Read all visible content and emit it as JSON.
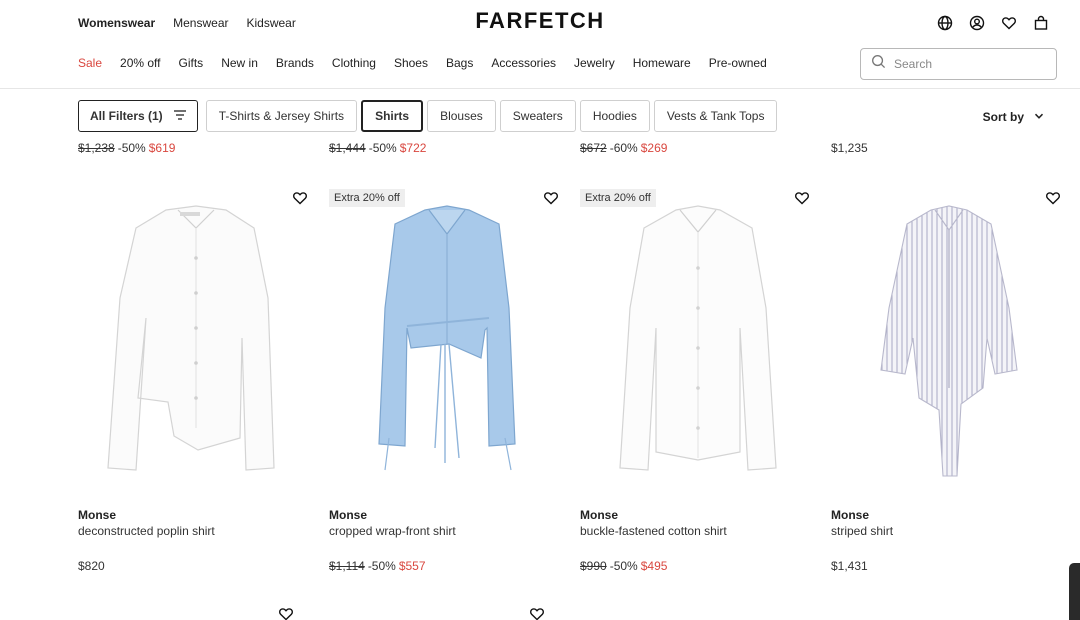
{
  "header": {
    "logo": "FARFETCH",
    "gender_tabs": [
      {
        "label": "Womenswear",
        "active": true
      },
      {
        "label": "Menswear",
        "active": false
      },
      {
        "label": "Kidswear",
        "active": false
      }
    ],
    "icons": [
      "globe-icon",
      "account-icon",
      "wishlist-icon",
      "bag-icon"
    ],
    "categories": [
      "Sale",
      "20% off",
      "Gifts",
      "New in",
      "Brands",
      "Clothing",
      "Shoes",
      "Bags",
      "Accessories",
      "Jewelry",
      "Homeware",
      "Pre-owned"
    ],
    "search_placeholder": "Search"
  },
  "filters": {
    "all_filters_label": "All Filters (1)",
    "chips": [
      {
        "label": "T-Shirts & Jersey Shirts",
        "selected": false
      },
      {
        "label": "Shirts",
        "selected": true
      },
      {
        "label": "Blouses",
        "selected": false
      },
      {
        "label": "Sweaters",
        "selected": false
      },
      {
        "label": "Hoodies",
        "selected": false
      },
      {
        "label": "Vests & Tank Tops",
        "selected": false
      }
    ],
    "sort_label": "Sort by"
  },
  "previous_row_prices": [
    {
      "old": "$1,238",
      "discount": "-50%",
      "sale": "$619"
    },
    {
      "old": "$1,444",
      "discount": "-50%",
      "sale": "$722"
    },
    {
      "old": "$672",
      "discount": "-60%",
      "sale": "$269"
    },
    {
      "price": "$1,235"
    }
  ],
  "products": [
    {
      "brand": "Monse",
      "name": "deconstructed poplin shirt",
      "badge": "",
      "price": "$820",
      "old": "",
      "discount": "",
      "sale": "",
      "color": "#ffffff"
    },
    {
      "brand": "Monse",
      "name": "cropped wrap-front shirt",
      "badge": "Extra 20% off",
      "price": "",
      "old": "$1,114",
      "discount": "-50%",
      "sale": "$557",
      "color": "#9ec3e6"
    },
    {
      "brand": "Monse",
      "name": "buckle-fastened cotton shirt",
      "badge": "Extra 20% off",
      "price": "",
      "old": "$990",
      "discount": "-50%",
      "sale": "$495",
      "color": "#ffffff"
    },
    {
      "brand": "Monse",
      "name": "striped shirt",
      "badge": "",
      "price": "$1,431",
      "old": "",
      "discount": "",
      "sale": "",
      "color": "#e8e8f0"
    }
  ],
  "colors": {
    "sale": "#d9473f",
    "text": "#222222",
    "border": "#cfcfcf"
  }
}
